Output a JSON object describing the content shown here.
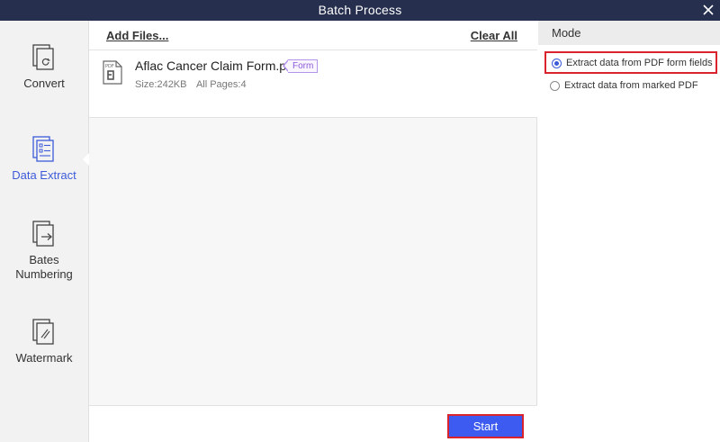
{
  "window": {
    "title": "Batch Process",
    "close_icon": "close-icon"
  },
  "sidebar": {
    "items": [
      {
        "label": "Convert",
        "icon": "convert-icon",
        "active": false
      },
      {
        "label": "Data Extract",
        "icon": "data-extract-icon",
        "active": true
      },
      {
        "label": "Bates\nNumbering",
        "icon": "bates-numbering-icon",
        "active": false
      },
      {
        "label": "Watermark",
        "icon": "watermark-icon",
        "active": false
      }
    ]
  },
  "toolbar": {
    "add_files_label": "Add Files...",
    "clear_all_label": "Clear All"
  },
  "files": [
    {
      "name": "Aflac Cancer Claim Form.pdf",
      "tag": "Form",
      "size": "Size:242KB",
      "pages": "All Pages:4",
      "icon": "pdf-file-icon"
    }
  ],
  "actions": {
    "start_label": "Start"
  },
  "mode": {
    "header": "Mode",
    "options": [
      {
        "label": "Extract data from PDF form fields",
        "selected": true
      },
      {
        "label": "Extract data from marked PDF",
        "selected": false
      }
    ]
  },
  "colors": {
    "titlebar": "#262f4e",
    "accent": "#3d5bd9",
    "highlight_border": "#d9232d",
    "form_tag": "#8a5ad8"
  }
}
